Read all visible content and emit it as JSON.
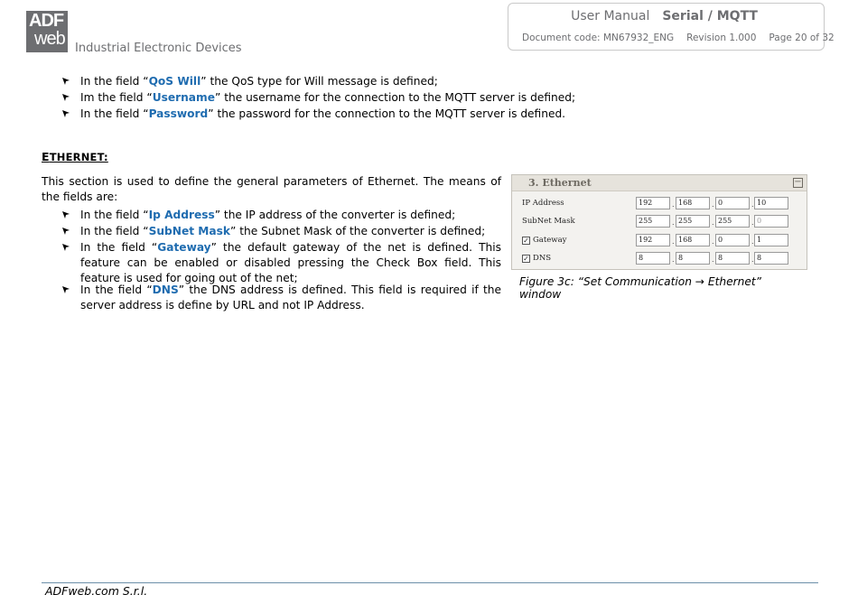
{
  "header": {
    "logo_top": "ADF",
    "logo_bottom": "web",
    "company": "Industrial Electronic Devices",
    "manual": "User Manual",
    "product": "Serial / MQTT",
    "doc_code": "Document code: MN67932_ENG",
    "revision": "Revision 1.000",
    "page": "Page 20 of 32"
  },
  "top_bullets": [
    {
      "pre": "In the field “",
      "key": "QoS Will",
      "post": "” the QoS type for Will message is defined;"
    },
    {
      "pre": "Im the field “",
      "key": "Username",
      "post": "” the username for the connection to the MQTT server is defined;"
    },
    {
      "pre": "In the field “",
      "key": "Password",
      "post": "” the password for the connection to the MQTT server is defined."
    }
  ],
  "section": {
    "first_letter": "E",
    "rest": "THERNET:",
    "intro": "This section is used to define the general parameters of Ethernet. The means of the fields are:"
  },
  "bullets": [
    {
      "pre": "In the field “",
      "key": "Ip Address",
      "post": "” the IP address of the converter is defined;"
    },
    {
      "pre": "In the field “",
      "key": "SubNet Mask",
      "post": "” the Subnet Mask of the converter is defined;"
    },
    {
      "pre": "In the field “",
      "key": "Gateway",
      "post": "” the default gateway of the net is defined. This feature can be enabled or disabled pressing the Check Box field. This feature is used for going out of the net;"
    },
    {
      "pre": "In the field “",
      "key": "DNS",
      "post": "” the DNS address is defined. This field is required if the server address is define by URL and not IP Address."
    }
  ],
  "panel": {
    "title": "3. Ethernet",
    "collapse_glyph": "−",
    "rows": [
      {
        "label": "IP Address",
        "checkbox": false,
        "octets": [
          "192",
          "168",
          "0",
          "10"
        ]
      },
      {
        "label": "SubNet Mask",
        "checkbox": false,
        "octets": [
          "255",
          "255",
          "255",
          "0"
        ]
      },
      {
        "label": "Gateway",
        "checkbox": true,
        "octets": [
          "192",
          "168",
          "0",
          "1"
        ]
      },
      {
        "label": "DNS",
        "checkbox": true,
        "octets": [
          "8",
          "8",
          "8",
          "8"
        ]
      }
    ]
  },
  "caption": "Figure 3c: “Set Communication → Ethernet” window",
  "footer": "ADFweb.com S.r.l."
}
